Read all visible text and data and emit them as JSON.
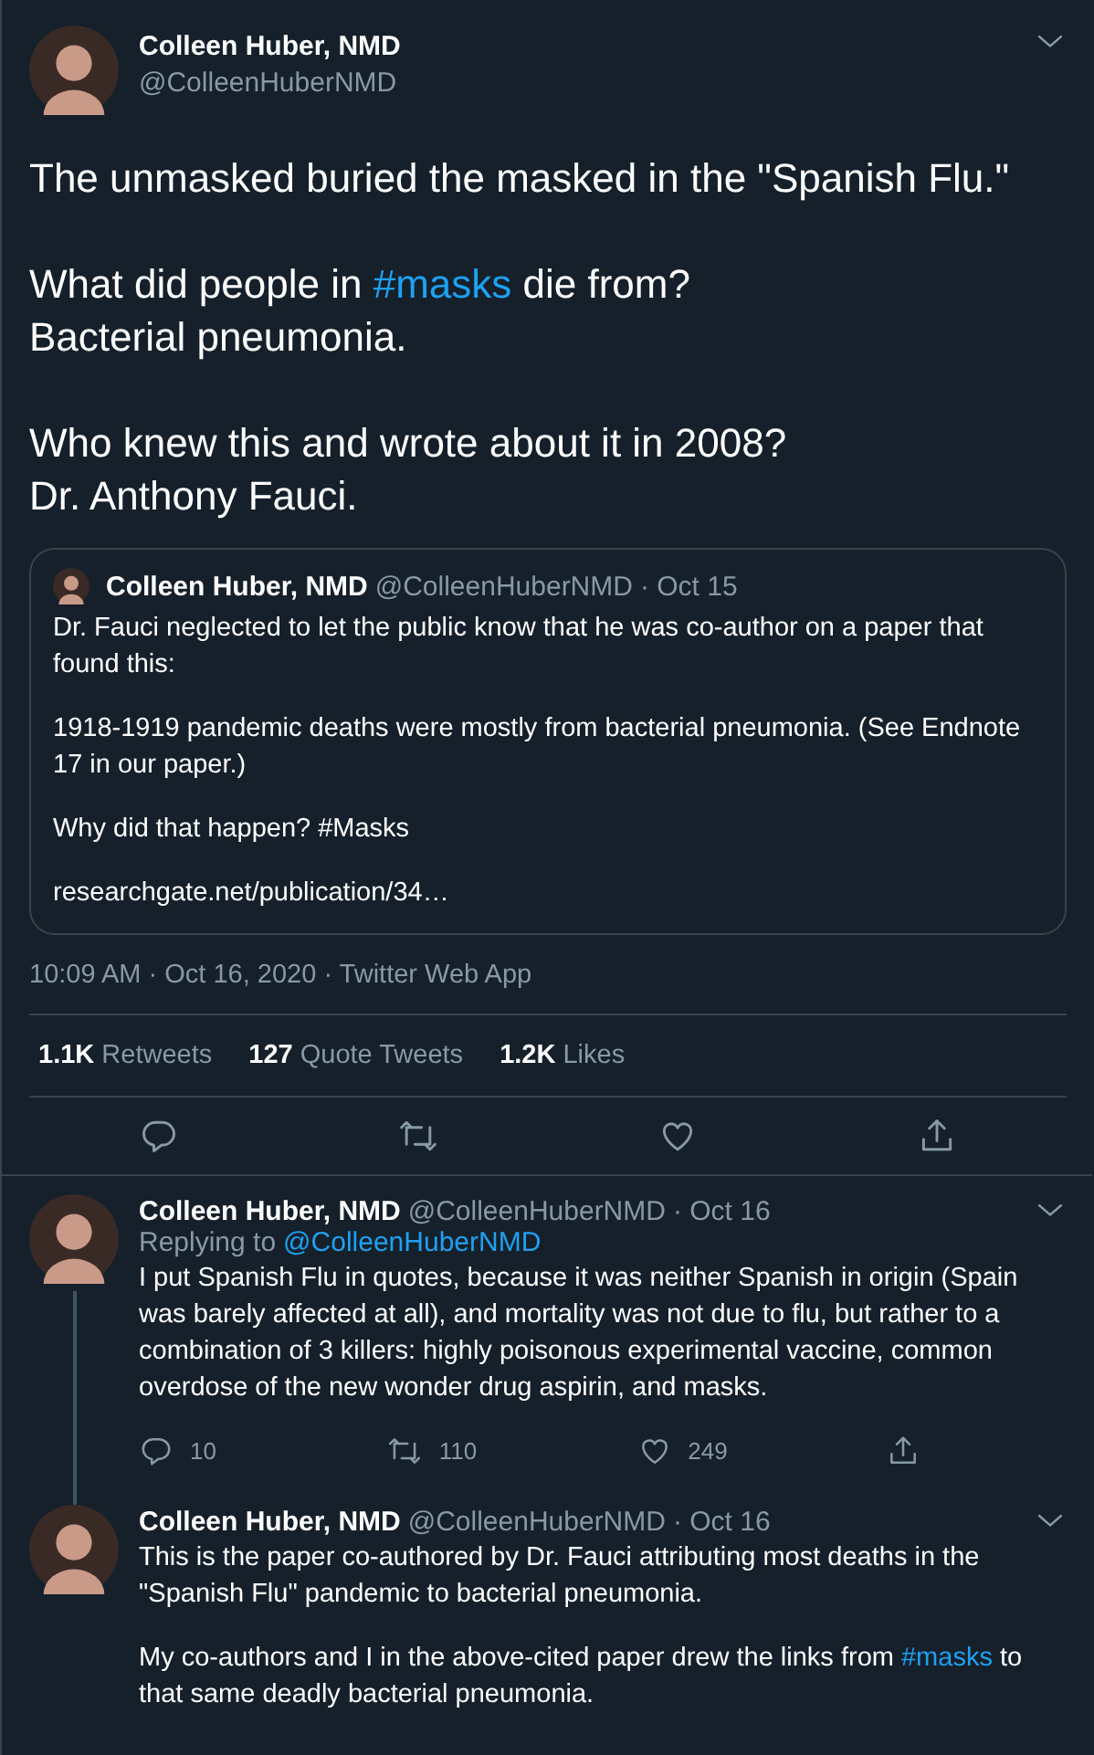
{
  "main_tweet": {
    "name": "Colleen Huber, NMD",
    "handle": "@ColleenHuberNMD",
    "paragraphs": [
      [
        {
          "kind": "text",
          "text": "The unmasked buried the masked in the \"Spanish Flu.\""
        }
      ],
      [
        {
          "kind": "text",
          "text": "What did people in "
        },
        {
          "kind": "hashtag",
          "text": "#masks"
        },
        {
          "kind": "text",
          "text": " die from?\nBacterial pneumonia."
        }
      ],
      [
        {
          "kind": "text",
          "text": "Who knew this and wrote about it in 2008?\nDr. Anthony Fauci."
        }
      ]
    ],
    "quote": {
      "name": "Colleen Huber, NMD",
      "handle": "@ColleenHuberNMD",
      "date": "· Oct 15",
      "paragraphs": [
        "Dr. Fauci neglected to let the public know that he was co-author on a paper that found this:",
        "1918-1919 pandemic deaths were mostly from bacterial pneumonia. (See Endnote 17 in our paper.)",
        "Why did that happen?  #Masks",
        "researchgate.net/publication/34…"
      ]
    },
    "timestamp": "10:09 AM · Oct 16, 2020 · Twitter Web App",
    "stats": [
      {
        "count": "1.1K",
        "label": "Retweets"
      },
      {
        "count": "127",
        "label": "Quote Tweets"
      },
      {
        "count": "1.2K",
        "label": "Likes"
      }
    ],
    "actions": [
      {
        "kind": "reply"
      },
      {
        "kind": "retweet"
      },
      {
        "kind": "like"
      },
      {
        "kind": "share"
      }
    ]
  },
  "replies": [
    {
      "name": "Colleen Huber, NMD",
      "handle": "@ColleenHuberNMD",
      "date": "· Oct 16",
      "replying_label": "Replying to",
      "replying_to": "@ColleenHuberNMD",
      "thread_below": true,
      "paragraphs": [
        [
          {
            "kind": "text",
            "text": "I put Spanish Flu in quotes, because it was neither Spanish in origin (Spain was barely affected at all), and mortality was not due to flu, but rather to a combination of 3 killers: highly poisonous experimental vaccine, common overdose of the new wonder drug aspirin, and masks."
          }
        ]
      ],
      "actions": [
        {
          "kind": "reply",
          "count": "10"
        },
        {
          "kind": "retweet",
          "count": "110"
        },
        {
          "kind": "like",
          "count": "249"
        },
        {
          "kind": "share"
        }
      ]
    },
    {
      "name": "Colleen Huber, NMD",
      "handle": "@ColleenHuberNMD",
      "date": "· Oct 16",
      "thread_above": true,
      "paragraphs": [
        [
          {
            "kind": "text",
            "text": "This is the paper co-authored by Dr. Fauci attributing most deaths in the \"Spanish Flu\" pandemic to bacterial pneumonia."
          }
        ],
        [
          {
            "kind": "text",
            "text": "My co-authors and I in the above-cited paper drew the links from "
          },
          {
            "kind": "hashtag",
            "text": "#masks"
          },
          {
            "kind": "text",
            "text": " to that same deadly bacterial pneumonia."
          }
        ]
      ]
    }
  ]
}
